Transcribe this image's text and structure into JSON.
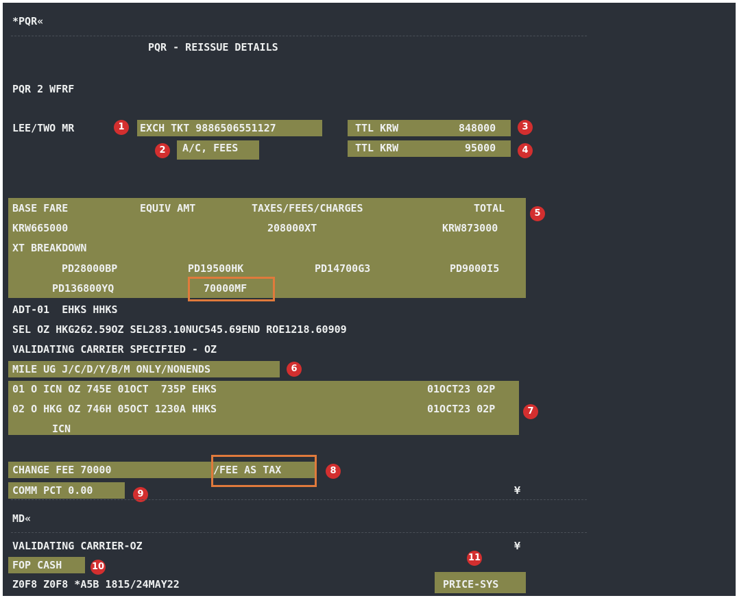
{
  "header": {
    "command": "*PQR«",
    "title": "PQR - REISSUE DETAILS",
    "pqr_id": "PQR 2 WFRF"
  },
  "passenger": {
    "name": "LEE/TWO MR",
    "exch_tkt": "EXCH TKT 9886506551127",
    "ac_fees": "A/C, FEES",
    "ttl1_label": "TTL KRW",
    "ttl1_value": "848000",
    "ttl2_label": "TTL KRW",
    "ttl2_value": "95000"
  },
  "fare": {
    "headers": [
      "BASE FARE",
      "EQUIV AMT",
      "TAXES/FEES/CHARGES",
      "TOTAL"
    ],
    "base": "KRW665000",
    "taxes": "208000XT",
    "total": "KRW873000",
    "xt_label": "XT BREAKDOWN",
    "xt_row1": [
      "PD28000BP",
      "PD19500HK",
      "PD14700G3",
      "PD9000I5"
    ],
    "xt_row2": [
      "PD136800YQ",
      "70000MF"
    ]
  },
  "details": {
    "adt": "ADT-01  EHKS HHKS",
    "fare_calc": "SEL OZ HKG262.59OZ SEL283.10NUC545.69END ROE1218.60909",
    "validating": "VALIDATING CARRIER SPECIFIED - OZ",
    "mile": "MILE UG J/C/D/Y/B/M ONLY/NONENDS"
  },
  "segments": [
    {
      "left": "01 O ICN OZ 745E 01OCT  735P EHKS",
      "right": "01OCT23 02P"
    },
    {
      "left": "02 O HKG OZ 746H 05OCT 1230A HHKS",
      "right": "01OCT23 02P"
    }
  ],
  "segment_tail": "ICN",
  "fees": {
    "change": "CHANGE FEE 70000",
    "fee_as_tax": "/FEE AS TAX",
    "comm": "COMM PCT 0.00",
    "yen1": "¥"
  },
  "footer": {
    "md": "MD«",
    "validating": "VALIDATING CARRIER-OZ",
    "yen2": "¥",
    "fop": "FOP CASH",
    "sys_line": "Z0F8 Z0F8 *A5B 1815/24MAY22",
    "price_sys": "PRICE-SYS"
  },
  "badges": [
    "1",
    "2",
    "3",
    "4",
    "5",
    "6",
    "7",
    "8",
    "9",
    "10",
    "11"
  ],
  "colors": {
    "background": "#2b3038",
    "highlight": "#a8a853",
    "badge": "#d32f2f",
    "outline": "#e07a3c"
  }
}
